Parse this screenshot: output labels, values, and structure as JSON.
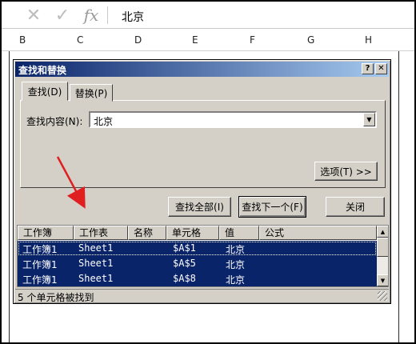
{
  "formula_bar": {
    "cancel_icon": "✕",
    "enter_icon": "✓",
    "fx_label": "fx",
    "value": "北京"
  },
  "columns": [
    "B",
    "C",
    "D",
    "E",
    "F",
    "G",
    "H"
  ],
  "dialog": {
    "title": "查找和替换",
    "help_label": "?",
    "close_label": "✕",
    "tabs": [
      "查找(D)",
      "替换(P)"
    ],
    "find_label": "查找内容(N):",
    "find_value": "北京",
    "dropdown_icon": "▼",
    "options_button": "选项(T) >>",
    "find_all_button": "查找全部(I)",
    "find_next_button": "查找下一个(F)",
    "close_button": "关闭",
    "results": {
      "headers": [
        "工作簿",
        "工作表",
        "名称",
        "单元格",
        "值",
        "公式"
      ],
      "rows": [
        {
          "workbook": "工作簿1",
          "sheet": "Sheet1",
          "name": "",
          "cell": "$A$1",
          "value": "北京",
          "formula": ""
        },
        {
          "workbook": "工作簿1",
          "sheet": "Sheet1",
          "name": "",
          "cell": "$A$5",
          "value": "北京",
          "formula": ""
        },
        {
          "workbook": "工作簿1",
          "sheet": "Sheet1",
          "name": "",
          "cell": "$A$8",
          "value": "北京",
          "formula": ""
        }
      ]
    },
    "status": "5 个单元格被找到",
    "scroll_up_icon": "▲",
    "scroll_down_icon": "▼"
  },
  "colors": {
    "titlebar_start": "#0a246a",
    "titlebar_end": "#a6caf0",
    "selection": "#0a246a",
    "dialog_face": "#d4d0c8",
    "annotation_arrow": "#e02020"
  }
}
